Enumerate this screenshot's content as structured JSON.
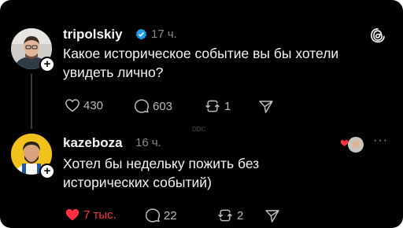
{
  "post1": {
    "username": "tripolskiy",
    "time": "17 ч.",
    "text": "Какое историческое событие вы бы хотели\nувидеть лично?",
    "likes": "430",
    "comments": "603",
    "reposts": "1"
  },
  "post2": {
    "username": "kazeboza",
    "time": "16 ч.",
    "text": "Хотел бы недельку пожить без\nисторических событий)",
    "likes": "7 тыс.",
    "comments": "22",
    "reposts": "2",
    "liked": true
  },
  "watermark": "DDC",
  "icons": {
    "verified": "verified-badge-icon",
    "app": "threads-logo-icon",
    "like": "heart-icon",
    "comment": "comment-bubble-icon",
    "repost": "repost-icon",
    "share": "share-send-icon",
    "more": "more-dots-icon"
  },
  "colors": {
    "background": "#000000",
    "text": "#f3f3f3",
    "muted": "#8a8a8a",
    "verified": "#1d9bf0",
    "liked": "#ff3040"
  }
}
